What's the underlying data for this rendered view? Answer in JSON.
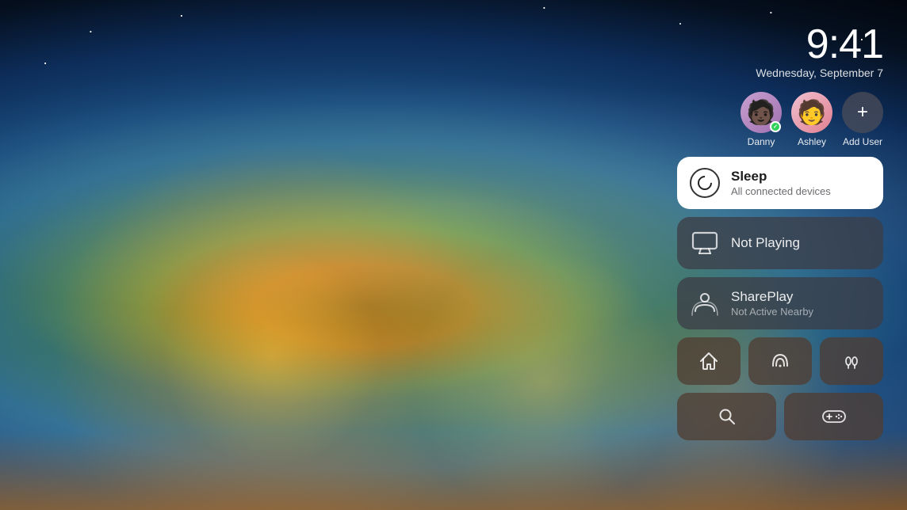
{
  "background": {
    "description": "Earth from space with city lights visible"
  },
  "clock": {
    "time": "9:41",
    "date": "Wednesday, September 7"
  },
  "users": [
    {
      "id": "danny",
      "name": "Danny",
      "emoji": "🧑🏿",
      "active": true
    },
    {
      "id": "ashley",
      "name": "Ashley",
      "emoji": "🧑",
      "active": false
    }
  ],
  "add_user": {
    "label": "Add User",
    "icon": "+"
  },
  "sleep_card": {
    "title": "Sleep",
    "subtitle": "All connected devices",
    "icon": "sleep-icon"
  },
  "not_playing_card": {
    "label": "Not Playing",
    "icon": "tv-icon"
  },
  "shareplay_card": {
    "title": "SharePlay",
    "subtitle": "Not Active Nearby",
    "icon": "shareplay-icon"
  },
  "action_buttons": [
    {
      "id": "home",
      "icon": "🏠",
      "label": "Home"
    },
    {
      "id": "airplay",
      "icon": "📡",
      "label": "AirPlay"
    },
    {
      "id": "airpods",
      "icon": "🎧",
      "label": "AirPods"
    }
  ],
  "action_buttons_row2": [
    {
      "id": "search",
      "icon": "🔍",
      "label": "Search"
    },
    {
      "id": "gamepad",
      "icon": "🎮",
      "label": "Game Controller"
    }
  ],
  "accent_color": "#ffffff",
  "card_bg": "rgba(60,60,70,0.75)"
}
